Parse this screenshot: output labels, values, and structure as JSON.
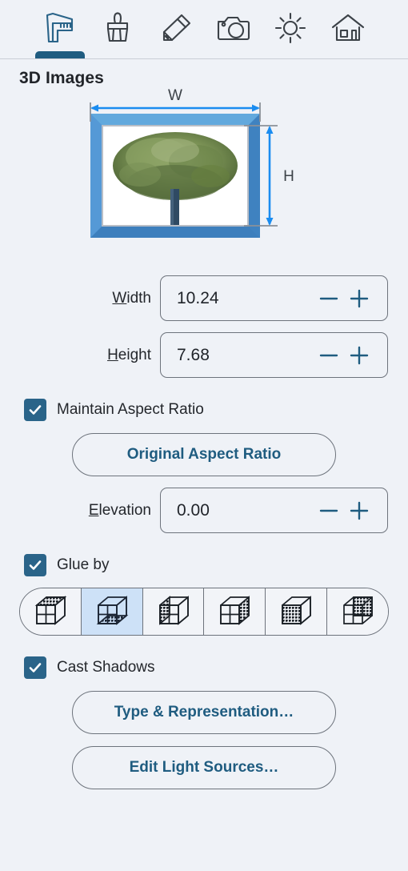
{
  "toolbar": {
    "items": [
      {
        "name": "caliper-icon",
        "label": "Dimensions",
        "active": true
      },
      {
        "name": "brush-icon",
        "label": "Materials",
        "active": false
      },
      {
        "name": "pencil-icon",
        "label": "Edit",
        "active": false
      },
      {
        "name": "camera-icon",
        "label": "Camera",
        "active": false
      },
      {
        "name": "sun-icon",
        "label": "Lighting",
        "active": false
      },
      {
        "name": "house-icon",
        "label": "Building",
        "active": false
      }
    ]
  },
  "panel": {
    "title": "3D Images"
  },
  "preview": {
    "width_label": "W",
    "height_label": "H",
    "image_alt": "tree"
  },
  "fields": [
    {
      "label_prefix": "",
      "accel": "W",
      "label_suffix": "idth",
      "value": "10.24",
      "name": "width"
    },
    {
      "label_prefix": "",
      "accel": "H",
      "label_suffix": "eight",
      "value": "7.68",
      "name": "height"
    }
  ],
  "maintain_aspect": {
    "label": "Maintain Aspect Ratio",
    "checked": true
  },
  "original_aspect_button": {
    "label": "Original Aspect Ratio"
  },
  "elevation": {
    "accel": "E",
    "label_suffix": "levation",
    "value": "0.00"
  },
  "glue_by": {
    "label": "Glue by",
    "checked": true,
    "options": [
      {
        "name": "glue-top-face",
        "face": "top",
        "selected": false
      },
      {
        "name": "glue-bottom-face",
        "face": "bottom",
        "selected": true
      },
      {
        "name": "glue-left-face",
        "face": "left",
        "selected": false
      },
      {
        "name": "glue-right-face",
        "face": "right",
        "selected": false
      },
      {
        "name": "glue-front-face",
        "face": "front",
        "selected": false
      },
      {
        "name": "glue-back-face",
        "face": "back",
        "selected": false
      }
    ]
  },
  "cast_shadows": {
    "label": "Cast Shadows",
    "checked": true
  },
  "buttons": {
    "type_representation": "Type & Representation…",
    "edit_light_sources": "Edit Light Sources…"
  },
  "colors": {
    "panel_bg": "#eff2f7",
    "accent": "#1f5c80",
    "checkbox": "#2a6489",
    "dimension_arrow": "#1a8cf0",
    "frame_blue": "#4a90d0",
    "selected_segment": "#cde1f7",
    "border": "#6d737c"
  }
}
